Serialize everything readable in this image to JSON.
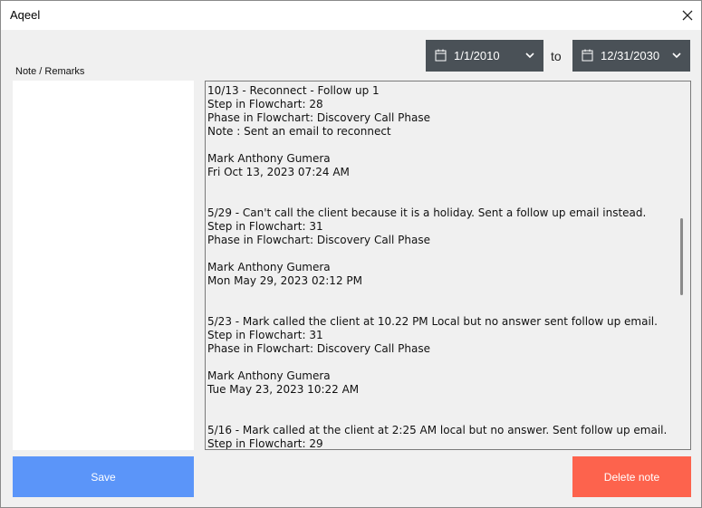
{
  "window": {
    "title": "Aqeel",
    "close_icon": "close-icon"
  },
  "date_range": {
    "from": "1/1/2010",
    "separator": "to",
    "to": "12/31/2030",
    "calendar_icon": "calendar-icon",
    "dropdown_icon": "chevron-down-icon"
  },
  "note": {
    "label": "Note / Remarks",
    "value": ""
  },
  "log": {
    "entries": [
      {
        "title": "10/13 - Reconnect - Follow up 1",
        "step": "Step in Flowchart: 28",
        "phase": "Phase in Flowchart: Discovery Call Phase",
        "note": "Note : Sent an email to reconnect",
        "author": "Mark Anthony Gumera",
        "timestamp": "Fri Oct 13, 2023 07:24 AM"
      },
      {
        "title": "5/29 - Can't call the client because it is a holiday. Sent a follow up email instead.",
        "step": "Step in Flowchart: 31",
        "phase": "Phase in Flowchart: Discovery Call Phase",
        "note": "",
        "author": "Mark Anthony Gumera",
        "timestamp": "Mon May 29, 2023 02:12 PM"
      },
      {
        "title": "5/23 - Mark called the client at 10.22 PM Local but no answer sent follow up email.",
        "step": "Step in Flowchart: 31",
        "phase": "Phase in Flowchart: Discovery Call Phase",
        "note": "",
        "author": "Mark Anthony Gumera",
        "timestamp": "Tue May 23, 2023 10:22 AM"
      },
      {
        "title": "5/16 - Mark called at the client at 2:25 AM local but no answer. Sent follow up email.",
        "step": "Step in Flowchart: 29",
        "phase": "",
        "note": "",
        "author": "",
        "timestamp": ""
      }
    ]
  },
  "buttons": {
    "save": "Save",
    "delete": "Delete note"
  },
  "colors": {
    "save": "#5b95f9",
    "delete": "#fd634d",
    "date_box": "#4a5157"
  }
}
